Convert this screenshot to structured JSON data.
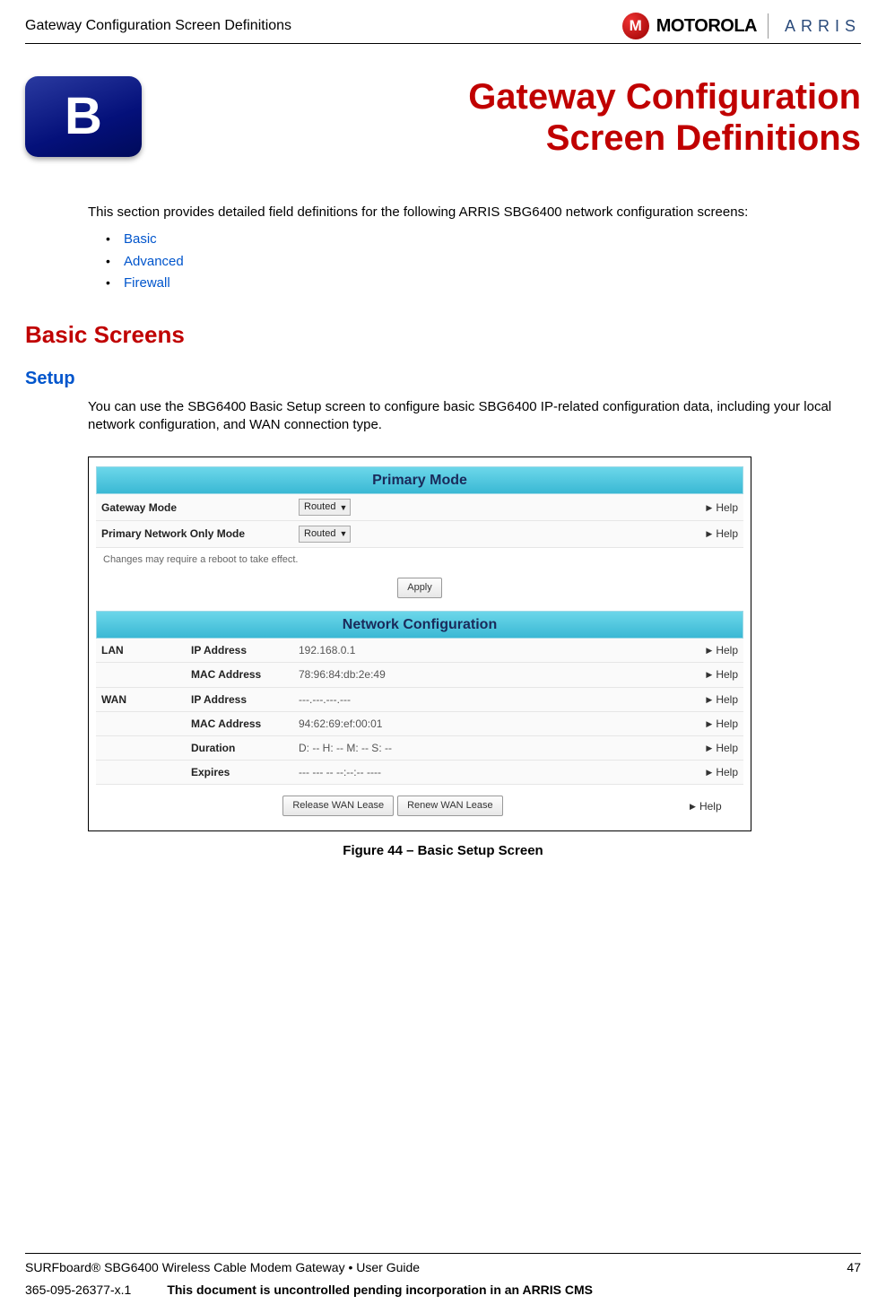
{
  "header": {
    "title": "Gateway Configuration Screen Definitions",
    "logos": {
      "motorola_icon_letter": "M",
      "motorola_text": "MOTOROLA",
      "arris_text": "ARRIS"
    }
  },
  "appendix": {
    "letter": "B",
    "chapter_title_line1": "Gateway Configuration",
    "chapter_title_line2": "Screen Definitions"
  },
  "intro": {
    "text": "This section provides detailed field definitions for the following ARRIS SBG6400 network configuration screens:",
    "links": [
      "Basic",
      "Advanced",
      "Firewall"
    ]
  },
  "sections": {
    "basic_screens": "Basic Screens",
    "setup": "Setup",
    "setup_text": "You can use the SBG6400 Basic Setup screen to configure basic SBG6400 IP-related configuration data, including your local network configuration, and WAN connection type."
  },
  "figure": {
    "panel1_title": "Primary Mode",
    "gateway_mode_label": "Gateway Mode",
    "gateway_mode_value": "Routed",
    "primary_net_label": "Primary Network Only Mode",
    "primary_net_value": "Routed",
    "reboot_note": "Changes may require a reboot to take effect.",
    "apply_btn": "Apply",
    "panel2_title": "Network Configuration",
    "lan_label": "LAN",
    "wan_label": "WAN",
    "ip_label": "IP Address",
    "mac_label": "MAC Address",
    "duration_label": "Duration",
    "expires_label": "Expires",
    "lan_ip": "192.168.0.1",
    "lan_mac": "78:96:84:db:2e:49",
    "wan_ip": "---.---.---.---",
    "wan_mac": "94:62:69:ef:00:01",
    "duration": "D: -- H: -- M: -- S: --",
    "expires": "--- --- -- --:--:-- ----",
    "release_btn": "Release WAN Lease",
    "renew_btn": "Renew WAN Lease",
    "help_text": "Help",
    "caption": "Figure 44 – Basic Setup Screen"
  },
  "footer": {
    "product": "SURFboard® SBG6400 Wireless Cable Modem Gateway • User Guide",
    "page": "47",
    "docnum": "365-095-26377-x.1",
    "notice": "This document is uncontrolled pending incorporation in an ARRIS CMS"
  }
}
